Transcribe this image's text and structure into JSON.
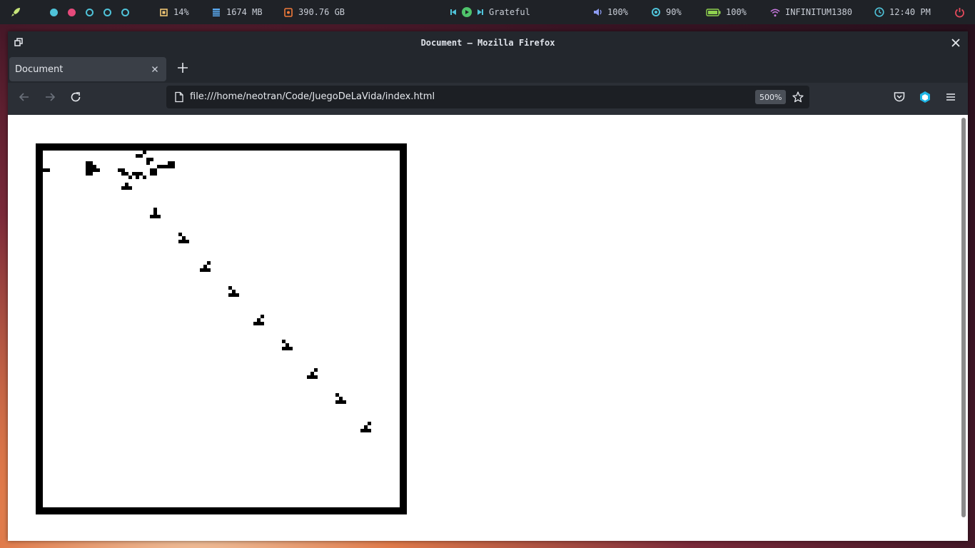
{
  "topbar": {
    "workspace_dots": [
      {
        "color": "#4fc3d9",
        "filled": true
      },
      {
        "color": "#e64a7b",
        "filled": true
      },
      {
        "color": "#4fc3d9",
        "filled": false
      },
      {
        "color": "#4fc3d9",
        "filled": false
      },
      {
        "color": "#4fc3d9",
        "filled": false
      }
    ],
    "cpu": "14%",
    "memory": "1674 MB",
    "disk": "390.76 GB",
    "media_title": "Grateful",
    "volume": "100%",
    "brightness": "90%",
    "battery": "100%",
    "network": "INFINITUM1380",
    "time": "12:40 PM",
    "colors": {
      "launcher": "#c7e57a",
      "cpu": "#f0c674",
      "memory": "#5aa9f0",
      "disk": "#f07a3a",
      "media": "#4fc36b",
      "volume": "#8c9bf0",
      "brightness": "#4fc3d9",
      "battery": "#8fd14f",
      "wifi": "#c678dd",
      "clock": "#4fc3d9",
      "power": "#e64a5c"
    }
  },
  "window": {
    "title": "Document — Mozilla Firefox"
  },
  "tabs": [
    {
      "label": "Document",
      "active": true
    }
  ],
  "navbar": {
    "url": "file:///home/neotran/Code/JuegoDeLaVida/index.html",
    "zoom": "500%"
  },
  "page": {
    "canvas_border_color": "#000000",
    "grid_size": 100,
    "live_cells": [
      [
        0,
        5
      ],
      [
        1,
        5
      ],
      [
        12,
        3
      ],
      [
        12,
        4
      ],
      [
        12,
        5
      ],
      [
        12,
        6
      ],
      [
        13,
        3
      ],
      [
        13,
        4
      ],
      [
        13,
        5
      ],
      [
        13,
        6
      ],
      [
        14,
        4
      ],
      [
        14,
        5
      ],
      [
        15,
        5
      ],
      [
        26,
        1
      ],
      [
        26,
        6
      ],
      [
        27,
        1
      ],
      [
        27,
        6
      ],
      [
        28,
        0
      ],
      [
        28,
        7
      ],
      [
        29,
        2
      ],
      [
        29,
        3
      ],
      [
        30,
        2
      ],
      [
        32,
        4
      ],
      [
        33,
        4
      ],
      [
        34,
        4
      ],
      [
        21,
        5
      ],
      [
        22,
        5
      ],
      [
        22,
        6
      ],
      [
        23,
        6
      ],
      [
        24,
        7
      ],
      [
        25,
        6
      ],
      [
        26,
        7
      ],
      [
        30,
        5
      ],
      [
        31,
        5
      ],
      [
        30,
        6
      ],
      [
        31,
        6
      ],
      [
        35,
        3
      ],
      [
        36,
        3
      ],
      [
        35,
        4
      ],
      [
        36,
        4
      ],
      [
        23,
        9
      ],
      [
        22,
        10
      ],
      [
        23,
        10
      ],
      [
        24,
        10
      ],
      [
        31,
        17
      ],
      [
        30,
        18
      ],
      [
        31,
        18
      ],
      [
        32,
        18
      ],
      [
        31,
        16
      ],
      [
        39,
        24
      ],
      [
        38,
        25
      ],
      [
        39,
        25
      ],
      [
        40,
        25
      ],
      [
        38,
        23
      ],
      [
        45,
        32
      ],
      [
        44,
        33
      ],
      [
        45,
        33
      ],
      [
        46,
        33
      ],
      [
        46,
        31
      ],
      [
        53,
        39
      ],
      [
        52,
        40
      ],
      [
        53,
        40
      ],
      [
        54,
        40
      ],
      [
        52,
        38
      ],
      [
        60,
        47
      ],
      [
        59,
        48
      ],
      [
        60,
        48
      ],
      [
        61,
        48
      ],
      [
        61,
        46
      ],
      [
        68,
        54
      ],
      [
        67,
        55
      ],
      [
        68,
        55
      ],
      [
        69,
        55
      ],
      [
        67,
        53
      ],
      [
        75,
        62
      ],
      [
        74,
        63
      ],
      [
        75,
        63
      ],
      [
        76,
        63
      ],
      [
        76,
        61
      ],
      [
        83,
        69
      ],
      [
        82,
        70
      ],
      [
        83,
        70
      ],
      [
        84,
        70
      ],
      [
        82,
        68
      ],
      [
        90,
        77
      ],
      [
        89,
        78
      ],
      [
        90,
        78
      ],
      [
        91,
        78
      ],
      [
        91,
        76
      ]
    ]
  }
}
